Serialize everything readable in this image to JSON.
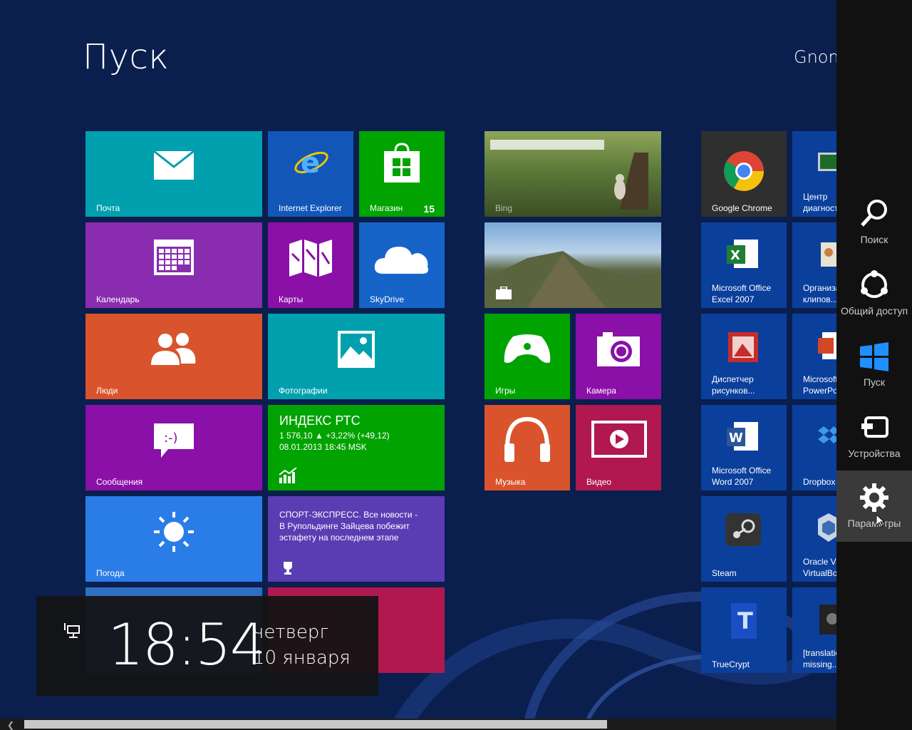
{
  "screen": {
    "title": "Пуск",
    "user": "Gnom"
  },
  "tiles": {
    "mail": "Почта",
    "ie": "Internet Explorer",
    "store": "Магазин",
    "store_badge": "15",
    "calendar": "Календарь",
    "maps": "Карты",
    "skydrive": "SkyDrive",
    "people": "Люди",
    "photos": "Фотографии",
    "messaging": "Сообщения",
    "finance_title": "ИНДЕКС РТС",
    "finance_line1": "1 576,10  ▲ +3,22% (+49,12)",
    "finance_line2": "08.01.2013 18:45 MSK",
    "weather": "Погода",
    "sport_news": "СПОРТ-ЭКСПРЕСС. Все новости - В Рупольдинге Зайцева побежит эстафету на последнем этапе",
    "bing": "Bing",
    "games": "Игры",
    "camera": "Камера",
    "music": "Музыка",
    "video": "Видео",
    "chrome": "Google Chrome",
    "diag": "Центр диагностики",
    "excel": "Microsoft Office Excel 2007",
    "clip": "Организатор клипов...",
    "picmgr": "Диспетчер рисунков...",
    "ppt": "Microsoft Office PowerPoint",
    "word": "Microsoft Office Word 2007",
    "dropbox": "Dropbox",
    "steam": "Steam",
    "vbox": "Oracle VM VirtualBox",
    "truecrypt": "TrueCrypt",
    "missing": "[translation missing..."
  },
  "charms": {
    "search": "Поиск",
    "share": "Общий доступ",
    "start": "Пуск",
    "devices": "Устройства",
    "settings": "Параметры"
  },
  "clock": {
    "time": "18:54",
    "day": "четверг",
    "date": "10 января"
  },
  "icons": {
    "mail": "envelope-icon",
    "ie": "internet-explorer-icon",
    "store": "store-bag-icon",
    "calendar": "calendar-icon",
    "maps": "map-icon",
    "skydrive": "cloud-icon",
    "people": "people-icon",
    "photos": "photo-icon",
    "messaging": "message-icon",
    "weather": "sun-icon",
    "games": "gamepad-icon",
    "camera": "camera-icon",
    "music": "headphones-icon",
    "video": "play-icon"
  },
  "colors": {
    "background": "#0a1f4e",
    "teal": "#009aa8",
    "blue": "#0a4fa6",
    "green": "#00a300",
    "purple": "#8b1fb0",
    "orange": "#d9532c",
    "crimson": "#b0184f",
    "sky": "#2377e0",
    "violet": "#5a3cb3",
    "desktop_blue": "#0b3f9c"
  }
}
